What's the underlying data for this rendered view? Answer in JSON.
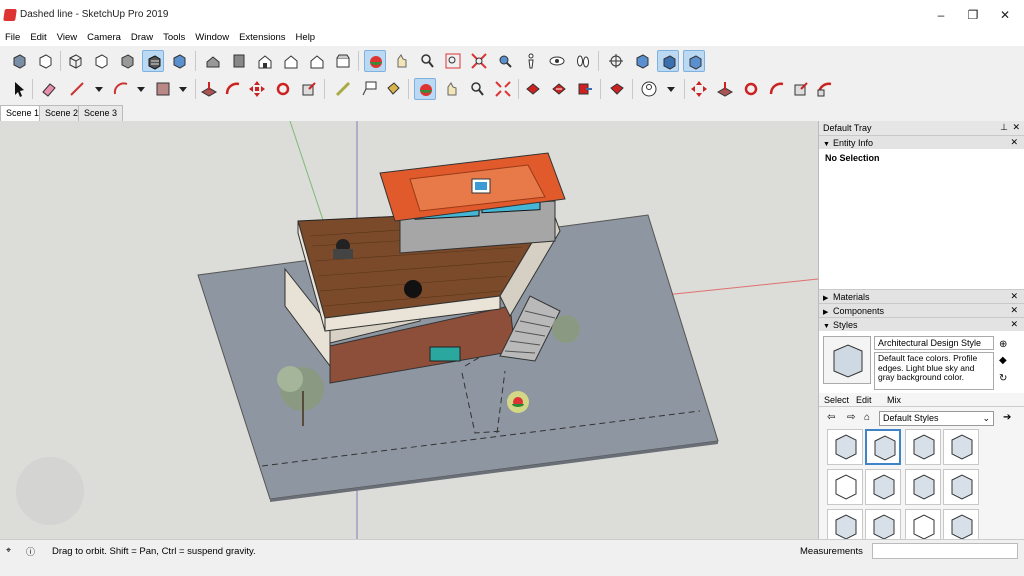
{
  "window": {
    "title": "Dashed line - SketchUp Pro 2019",
    "min": "–",
    "max": "❐",
    "close": "✕"
  },
  "menu": [
    "File",
    "Edit",
    "View",
    "Camera",
    "Draw",
    "Tools",
    "Window",
    "Extensions",
    "Help"
  ],
  "scenes": [
    "Scene 1",
    "Scene 2",
    "Scene 3"
  ],
  "tray": {
    "title": "Default Tray",
    "entity_info": {
      "label": "Entity Info",
      "selection": "No Selection"
    },
    "materials": "Materials",
    "components": "Components",
    "styles": {
      "label": "Styles",
      "style_name": "Architectural Design Style",
      "description": "Default face colors. Profile edges. Light blue sky and gray background color.",
      "tabs": [
        "Select",
        "Edit",
        "Mix"
      ],
      "collection": "Default Styles"
    }
  },
  "status": {
    "hint": "Drag to orbit. Shift = Pan, Ctrl = suspend gravity.",
    "measurements": "Measurements"
  },
  "colors": {
    "accent": "#3f84c9",
    "roof": "#e05a2b",
    "deck": "#7a4a2a",
    "ground": "#8e96a1"
  }
}
